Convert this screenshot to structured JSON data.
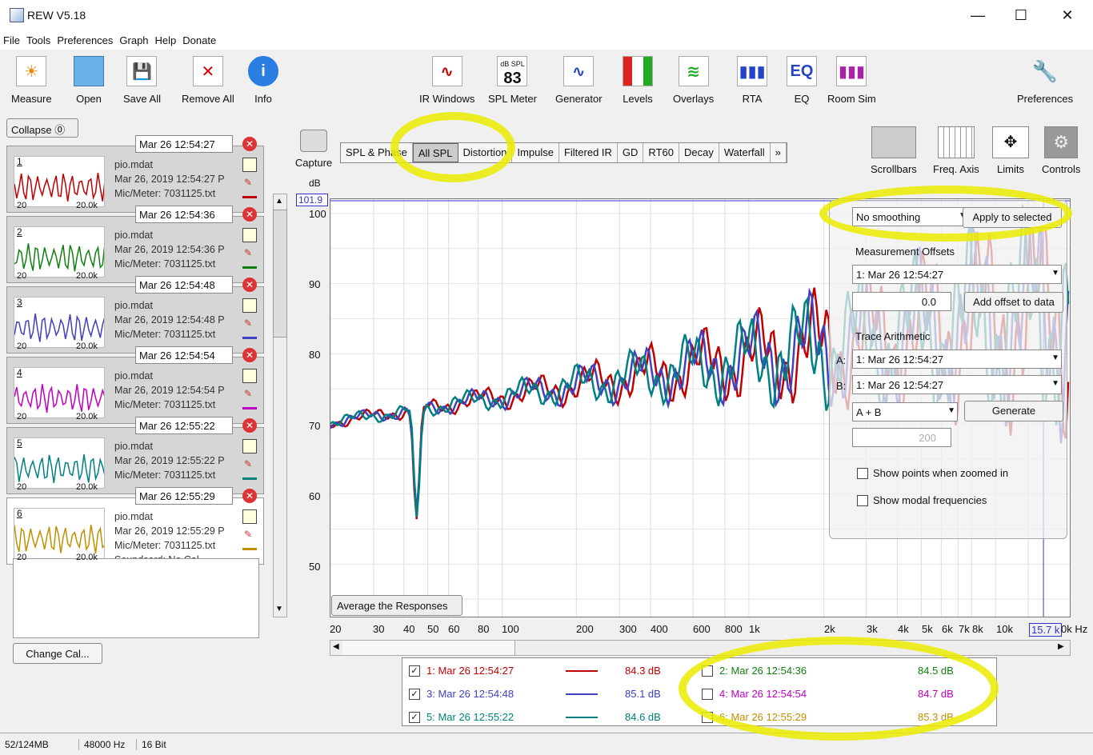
{
  "window": {
    "title": "REW V5.18",
    "minimize": "—",
    "maximize": "☐",
    "close": "✕"
  },
  "menu": [
    "File",
    "Tools",
    "Preferences",
    "Graph",
    "Help",
    "Donate"
  ],
  "toolbar": {
    "left": [
      {
        "label": "Measure",
        "icon": "measure-icon"
      },
      {
        "label": "Open",
        "icon": "folder-icon"
      },
      {
        "label": "Save All",
        "icon": "save-icon"
      },
      {
        "label": "Remove All",
        "icon": "remove-icon"
      },
      {
        "label": "Info",
        "icon": "info-icon"
      }
    ],
    "center": [
      {
        "label": "IR Windows",
        "icon": "ir-windows-icon"
      },
      {
        "label": "SPL Meter",
        "icon": "spl-meter-icon",
        "value": "83",
        "sub": "dB SPL"
      },
      {
        "label": "Generator",
        "icon": "generator-icon"
      },
      {
        "label": "Levels",
        "icon": "levels-icon"
      },
      {
        "label": "Overlays",
        "icon": "overlays-icon"
      },
      {
        "label": "RTA",
        "icon": "rta-icon"
      },
      {
        "label": "EQ",
        "icon": "eq-icon"
      },
      {
        "label": "Room Sim",
        "icon": "room-sim-icon"
      }
    ],
    "right": {
      "label": "Preferences",
      "icon": "wrench-icon"
    }
  },
  "left_panel": {
    "collapse_label": "Collapse",
    "measurements": [
      {
        "num": "1",
        "date": "Mar 26 12:54:27",
        "file": "pio.mdat",
        "full_date": "Mar 26, 2019 12:54:27 P",
        "mic": "Mic/Meter: 7031125.txt",
        "color": "#c00000"
      },
      {
        "num": "2",
        "date": "Mar 26 12:54:36",
        "file": "pio.mdat",
        "full_date": "Mar 26, 2019 12:54:36 P",
        "mic": "Mic/Meter: 7031125.txt",
        "color": "#108010"
      },
      {
        "num": "3",
        "date": "Mar 26 12:54:48",
        "file": "pio.mdat",
        "full_date": "Mar 26, 2019 12:54:48 P",
        "mic": "Mic/Meter: 7031125.txt",
        "color": "#4040c0"
      },
      {
        "num": "4",
        "date": "Mar 26 12:54:54",
        "file": "pio.mdat",
        "full_date": "Mar 26, 2019 12:54:54 P",
        "mic": "Mic/Meter: 7031125.txt",
        "color": "#c000c0"
      },
      {
        "num": "5",
        "date": "Mar 26 12:55:22",
        "file": "pio.mdat",
        "full_date": "Mar 26, 2019 12:55:22 P",
        "mic": "Mic/Meter: 7031125.txt",
        "color": "#008080"
      },
      {
        "num": "6",
        "date": "Mar 26 12:55:29",
        "file": "pio.mdat",
        "full_date": "Mar 26, 2019 12:55:29 P",
        "mic": "Mic/Meter: 7031125.txt",
        "soundcard": "Soundcard: No Cal",
        "color": "#c09000"
      }
    ],
    "thumb_x_min": "20",
    "thumb_x_max": "20.0k",
    "clipped_label": "S",
    "change_cal_label": "Change Cal..."
  },
  "capture_label": "Capture",
  "tabs": [
    "SPL & Phase",
    "All SPL",
    "Distortion",
    "Impulse",
    "Filtered IR",
    "GD",
    "RT60",
    "Decay",
    "Waterfall",
    "»"
  ],
  "active_tab": "All SPL",
  "right_tools": [
    {
      "label": "Scrollbars",
      "icon": "scrollbars-icon"
    },
    {
      "label": "Freq. Axis",
      "icon": "freq-axis-icon"
    },
    {
      "label": "Limits",
      "icon": "limits-icon"
    },
    {
      "label": "Controls",
      "icon": "controls-icon"
    }
  ],
  "graph": {
    "y_unit": "dB",
    "cursor_value": "101.9",
    "y_ticks": [
      "100",
      "90",
      "80",
      "70",
      "60",
      "50"
    ],
    "x_ticks": [
      "20",
      "30",
      "40",
      "50",
      "60",
      "80",
      "100",
      "200",
      "300",
      "400",
      "600",
      "800",
      "1k",
      "2k",
      "3k",
      "4k",
      "5k",
      "6k",
      "7k",
      "8k",
      "10k",
      "15.7 k"
    ],
    "x_unit": "0k Hz",
    "average_label": "Average the Responses"
  },
  "controls": {
    "smoothing": "No  smoothing",
    "apply_label": "Apply to selected",
    "offsets_title": "Measurement Offsets",
    "offset_select": "1: Mar 26 12:54:27",
    "offset_value": "0.0",
    "add_offset_label": "Add offset to data",
    "trace_title": "Trace Arithmetic",
    "a_label": "A:",
    "a_value": "1: Mar 26 12:54:27",
    "b_label": "B:",
    "b_value": "1: Mar 26 12:54:27",
    "op_value": "A + B",
    "generate_label": "Generate",
    "points_value": "200",
    "show_points_label": "Show points when zoomed in",
    "show_modal_label": "Show modal frequencies"
  },
  "legend": [
    {
      "label": "1: Mar 26 12:54:27",
      "value": "84.3 dB",
      "color": "#c00000",
      "checked": true
    },
    {
      "label": "2: Mar 26 12:54:36",
      "value": "84.5 dB",
      "color": "#108010",
      "checked": false
    },
    {
      "label": "3: Mar 26 12:54:48",
      "value": "85.1 dB",
      "color": "#4040c0",
      "checked": true
    },
    {
      "label": "4: Mar 26 12:54:54",
      "value": "84.7 dB",
      "color": "#c000c0",
      "checked": false
    },
    {
      "label": "5: Mar 26 12:55:22",
      "value": "84.6 dB",
      "color": "#008080",
      "checked": true
    },
    {
      "label": "6: Mar 26 12:55:29",
      "value": "85.3 dB",
      "color": "#c09000",
      "checked": false
    }
  ],
  "status": {
    "memory": "52/124MB",
    "rate": "48000 Hz",
    "bits": "16 Bit"
  }
}
